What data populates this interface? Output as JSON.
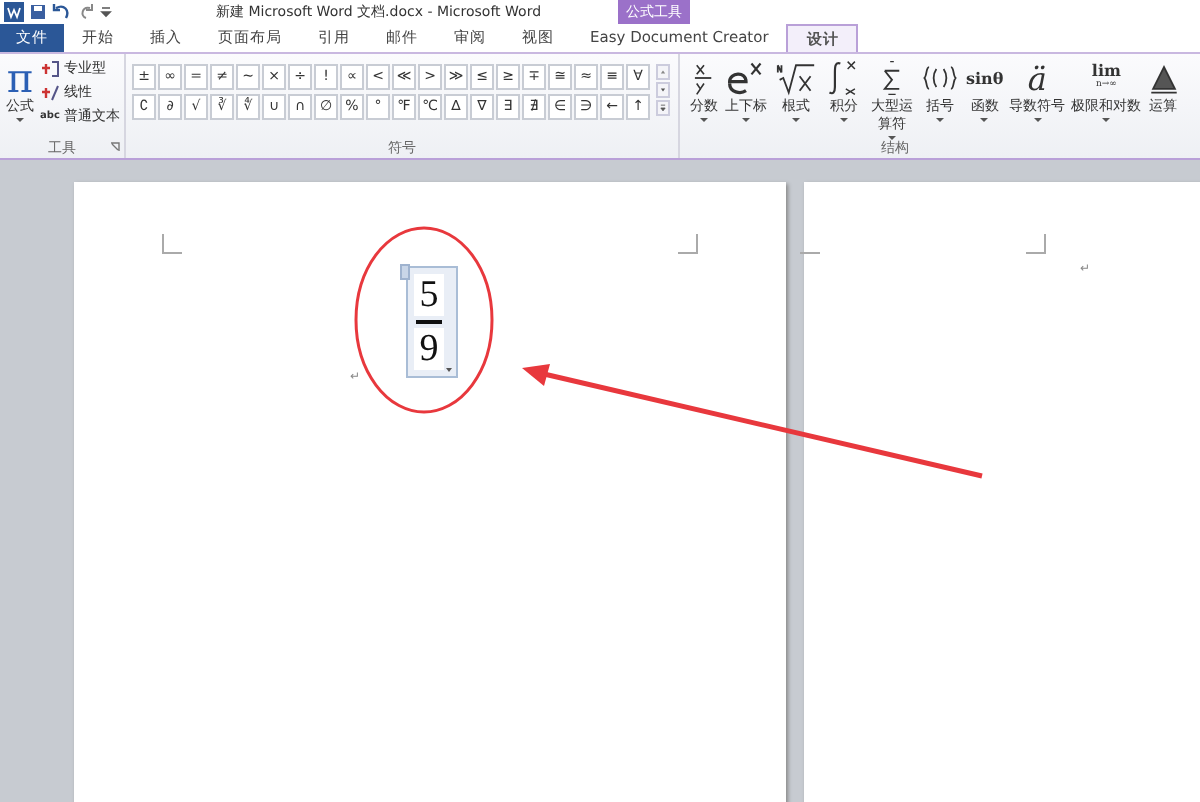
{
  "window": {
    "title": "新建 Microsoft Word 文档.docx - Microsoft Word",
    "context_tab": "公式工具"
  },
  "tabs": [
    {
      "label": "文件",
      "kind": "file",
      "selected": false
    },
    {
      "label": "开始",
      "kind": "tab",
      "selected": false
    },
    {
      "label": "插入",
      "kind": "tab",
      "selected": false
    },
    {
      "label": "页面布局",
      "kind": "tab",
      "selected": false
    },
    {
      "label": "引用",
      "kind": "tab",
      "selected": false
    },
    {
      "label": "邮件",
      "kind": "tab",
      "selected": false
    },
    {
      "label": "审阅",
      "kind": "tab",
      "selected": false
    },
    {
      "label": "视图",
      "kind": "tab",
      "selected": false
    },
    {
      "label": "Easy Document Creator",
      "kind": "tab",
      "selected": false
    },
    {
      "label": "设计",
      "kind": "context",
      "selected": true
    }
  ],
  "tools": {
    "label": "工具",
    "icon": "π",
    "equation": "公式",
    "items": [
      {
        "label": "专业型",
        "kind": "pro"
      },
      {
        "label": "线性",
        "kind": "linear"
      },
      {
        "label": "普通文本",
        "kind": "text",
        "tag": "abc"
      }
    ]
  },
  "symbols": {
    "label": "符号",
    "rows": [
      [
        "±",
        "∞",
        "=",
        "≠",
        "~",
        "×",
        "÷",
        "!",
        "∝",
        "<",
        "≪",
        ">",
        "≫",
        "≤",
        "≥",
        "∓",
        "≅",
        "≈",
        "≡",
        "∀"
      ],
      [
        "∁",
        "∂",
        "√",
        "∛",
        "∜",
        "∪",
        "∩",
        "∅",
        "%",
        "°",
        "℉",
        "℃",
        "∆",
        "∇",
        "∃",
        "∄",
        "∈",
        "∋",
        "←",
        "↑"
      ]
    ]
  },
  "structures": {
    "label": "结构",
    "items": [
      {
        "label": "分数",
        "kind": "fraction",
        "dropdown": true
      },
      {
        "label": "上下标",
        "kind": "script",
        "dropdown": true
      },
      {
        "label": "根式",
        "kind": "radical",
        "dropdown": true
      },
      {
        "label": "积分",
        "kind": "integral",
        "dropdown": true
      },
      {
        "label": "大型运算符",
        "kind": "largeop",
        "dropdown": true
      },
      {
        "label": "括号",
        "kind": "bracket",
        "dropdown": true
      },
      {
        "label": "函数",
        "kind": "function",
        "glyph": "sinθ",
        "dropdown": true
      },
      {
        "label": "导数符号",
        "kind": "accent",
        "glyph": "ä",
        "dropdown": true
      },
      {
        "label": "极限和对数",
        "kind": "limit",
        "glyph": "lim",
        "sub": "n→∞",
        "dropdown": true
      },
      {
        "label": "运算",
        "kind": "operator",
        "dropdown": false
      }
    ]
  },
  "document": {
    "equation": {
      "numerator": "5",
      "denominator": "9"
    },
    "paragraph_marks": [
      "↵",
      "↵"
    ]
  }
}
